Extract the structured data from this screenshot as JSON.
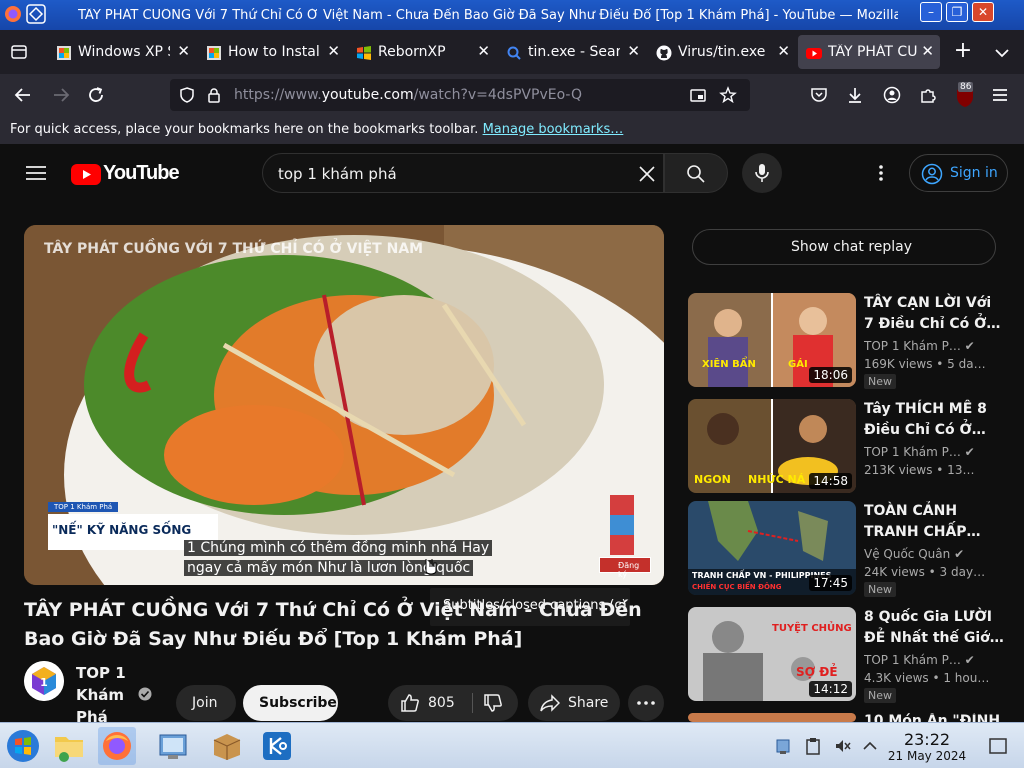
{
  "window": {
    "title": "TÂY PHÁT CUỒNG Với 7 Thứ Chỉ Có Ở Việt Nam - Chưa Đến Bao Giờ Đã Say Như Điếu Đổ [Top 1 Khám Phá] - YouTube — Mozilla Firefox"
  },
  "tabs": [
    {
      "label": "Windows XP Startup",
      "icon": "windows-xp-icon",
      "active": false
    },
    {
      "label": "How to Install",
      "icon": "page-icon",
      "active": false
    },
    {
      "label": "RebornXP",
      "icon": "windows-flag-icon",
      "active": false
    },
    {
      "label": "tin.exe - Search",
      "icon": "search-icon",
      "active": false
    },
    {
      "label": "Virus/tin.exe at",
      "icon": "github-icon",
      "active": false
    },
    {
      "label": "TÂY PHÁT CUỒNG",
      "icon": "youtube-icon",
      "active": true
    }
  ],
  "nav": {
    "url_prefix": "https://www.",
    "url_domain": "youtube.com",
    "url_suffix": "/watch?v=4dsPVPvEo-Q",
    "extension_badge": "86"
  },
  "bookmarks": {
    "text": "For quick access, place your bookmarks here on the bookmarks toolbar.",
    "link": "Manage bookmarks…"
  },
  "youtube": {
    "logo_text": "YouTube",
    "search_value": "top 1 khám phá",
    "sign_in": "Sign in"
  },
  "player": {
    "overlay_title": "TÂY PHÁT CUỒNG VỚI 7 THỨ CHỈ CÓ Ở VIỆT NAM",
    "lower_tag": "TOP 1 Khám Phá",
    "lower_third": "\"NẾ\" KỸ NĂNG SỐNG",
    "caption_line1": "1 Chúng mình có thêm đồng minh nhá Hay",
    "caption_line2": "ngay cả mấy món Như là lươn lòng quốc",
    "subscribe_badge": "Đăng ký",
    "tooltip": "Subtitles/closed captions (c)"
  },
  "video": {
    "title": "TÂY PHÁT CUỒNG Với 7 Thứ Chỉ Có Ở Việt Nam - Chưa Đến Bao Giờ Đã Say Như Điếu Đổ [Top 1 Khám Phá]",
    "channel": "TOP 1 Khám Phá",
    "join": "Join",
    "subscribe": "Subscribe",
    "likes": "805",
    "share": "Share"
  },
  "sidebar": {
    "chat_replay": "Show chat replay",
    "items": [
      {
        "title": "TÂY CẠN LỜI Với 7 Điều Chỉ Có Ở…",
        "channel": "TOP 1 Khám P…",
        "meta": "169K views • 5 da…",
        "duration": "18:06",
        "badge": "New",
        "verified": true,
        "thumb_text": "XIÊN BẨN",
        "thumb_text2": "GÁI"
      },
      {
        "title": "Tây THÍCH MÊ 8 Điều Chỉ Có Ở…",
        "channel": "TOP 1 Khám P…",
        "meta": "213K views • 13…",
        "duration": "14:58",
        "badge": "",
        "verified": true,
        "thumb_text": "NGON",
        "thumb_text2": "NHỨC NÁ"
      },
      {
        "title": "TOÀN CẢNH TRANH CHẤP…",
        "channel": "Vệ Quốc Quân",
        "meta": "24K views • 3 day…",
        "duration": "17:45",
        "badge": "New",
        "verified": true,
        "thumb_text": "TRANH CHẤP VN - PHILIPPINES",
        "thumb_text2": "CHIẾN CỤC BIỂN ĐÔNG"
      },
      {
        "title": "8 Quốc Gia LƯỜI ĐẺ Nhất thế Giớ…",
        "channel": "TOP 1 Khám P…",
        "meta": "4.3K views • 1 hou…",
        "duration": "14:12",
        "badge": "New",
        "verified": true,
        "thumb_text": "TUYỆT CHỦNG",
        "thumb_text2": "SỢ ĐẺ"
      },
      {
        "title": "10 Món Ăn \"ĐỈNH",
        "channel": "",
        "meta": "",
        "duration": "",
        "badge": "",
        "verified": false,
        "thumb_text": "",
        "thumb_text2": ""
      }
    ]
  },
  "taskbar": {
    "time": "23:22",
    "date": "21 May 2024"
  },
  "colors": {
    "titlebar": "#1e5ac8",
    "browser_chrome": "#2b2a33",
    "youtube_bg": "#0f0f0f",
    "youtube_red": "#ff0000",
    "link_blue": "#3ea6ff",
    "taskbar": "#dfe9f5"
  }
}
